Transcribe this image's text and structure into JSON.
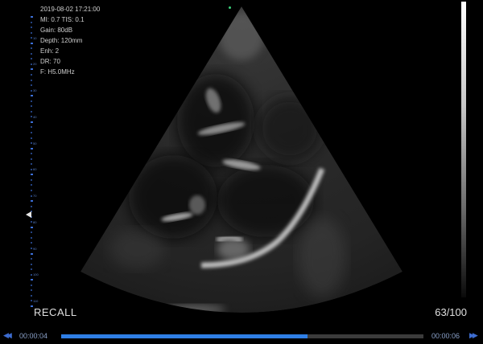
{
  "info": {
    "datetime": "2019-08-02 17:21:00",
    "mi_tis": "MI: 0.7   TIS: 0.1",
    "gain": "Gain: 80dB",
    "depth": "Depth: 120mm",
    "enh": "Enh: 2",
    "dr": "DR: 70",
    "freq": "F: H5.0MHz"
  },
  "ruler_labels": [
    "10",
    "20",
    "30",
    "40",
    "50",
    "60",
    "70",
    "80",
    "90",
    "100",
    "110"
  ],
  "recall_label": "RECALL",
  "frame_counter": "63/100",
  "playback": {
    "time_start": "00:00:04",
    "time_end": "00:00:06",
    "progress": 0.68
  },
  "icons": {
    "prev": "rewind-icon",
    "next": "fast-forward-icon"
  },
  "colors": {
    "accent": "#2f7fe6",
    "ruler": "#3c6fd8",
    "apex": "#3ad07a"
  }
}
